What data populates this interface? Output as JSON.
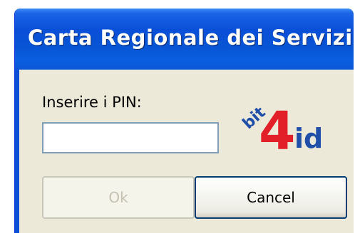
{
  "dialog": {
    "title": "Carta Regionale dei Servizi",
    "pin_label": "Inserire i PIN:",
    "pin_value": "",
    "ok_label": "Ok",
    "cancel_label": "Cancel"
  },
  "logo": {
    "icon": "bit4id-logo",
    "text_bit": "bit",
    "text_4": "4",
    "text_id": "id",
    "colors": {
      "bit": "#1f4fa8",
      "four": "#e2202a",
      "id": "#1f4fa8"
    }
  },
  "colors": {
    "titlebar": "#0a4fd8",
    "dialog_bg": "#ece9d8",
    "disabled_text": "#c5c2b2"
  }
}
